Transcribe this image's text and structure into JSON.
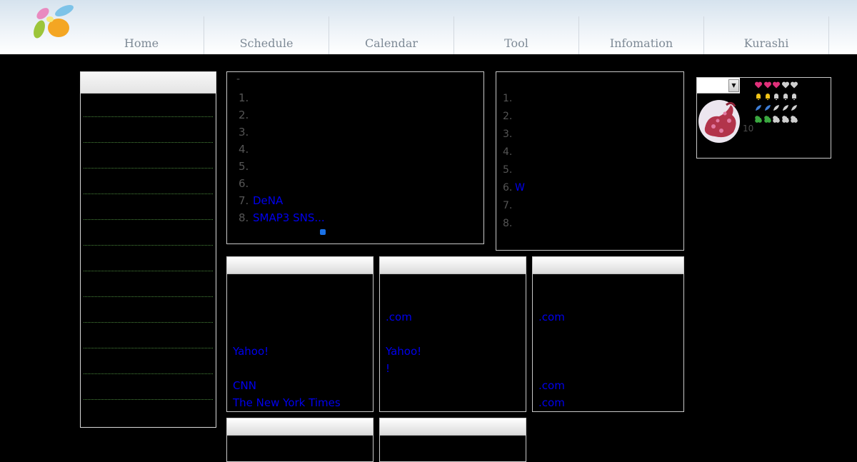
{
  "header": {
    "nav": [
      "Home",
      "Schedule",
      "Calendar",
      "Tool",
      "Infomation",
      "Kurashi"
    ]
  },
  "ranking_left": {
    "dash": "-",
    "items": [
      {
        "num": "1.",
        "text": ""
      },
      {
        "num": "2.",
        "text": ""
      },
      {
        "num": "3.",
        "text": ""
      },
      {
        "num": "4.",
        "text": ""
      },
      {
        "num": "5.",
        "text": ""
      },
      {
        "num": "6.",
        "text": ""
      },
      {
        "num": "7.",
        "text": "DeNA"
      },
      {
        "num": "8.",
        "text": "SMAP3 SNS..."
      }
    ]
  },
  "ranking_right": {
    "items": [
      {
        "num": "1.",
        "text": ""
      },
      {
        "num": "2.",
        "text": ""
      },
      {
        "num": "3.",
        "text": ""
      },
      {
        "num": "4.",
        "text": ""
      },
      {
        "num": "5.",
        "text": ""
      },
      {
        "num": "6.",
        "text": "W"
      },
      {
        "num": "7.",
        "text": ""
      },
      {
        "num": "8.",
        "text": ""
      }
    ]
  },
  "profile": {
    "level": "10",
    "icon_rows": [
      {
        "name": "heart-icon",
        "color": "#e0307a",
        "total": 5,
        "filled": 3
      },
      {
        "name": "bell-icon",
        "color": "#f2c418",
        "total": 5,
        "filled": 2
      },
      {
        "name": "feather-icon",
        "color": "#3f7fd8",
        "total": 5,
        "filled": 2
      },
      {
        "name": "flower-icon",
        "color": "#3aa840",
        "total": 5,
        "filled": 2
      }
    ]
  },
  "link_boxes": {
    "box1": [
      "Yahoo!",
      "CNN",
      "The New York Times"
    ],
    "box2": [
      ".com",
      "Yahoo!",
      "!"
    ],
    "box3": [
      ".com",
      ".com",
      ".com"
    ]
  },
  "colors": {
    "link": "#0000ee",
    "muted_number": "#555555",
    "pager_dot": "#1a72e8"
  }
}
